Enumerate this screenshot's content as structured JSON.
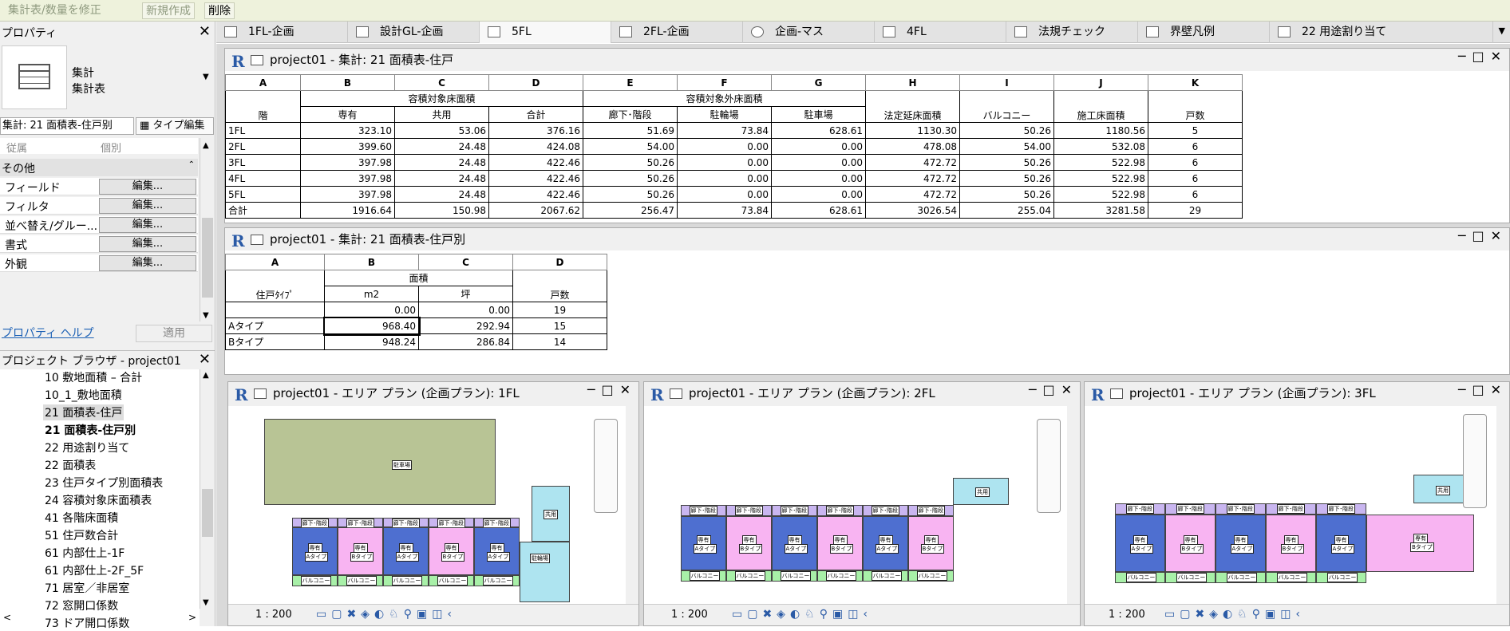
{
  "ribbon": {
    "modify_schedule": "集計表/数量を修正",
    "new": "新規作成",
    "delete": "削除"
  },
  "properties": {
    "title": "プロパティ",
    "type_line1": "集計",
    "type_line2": "集計表",
    "selector": "集計: 21 面積表-住戸别",
    "edit_type": "タイプ編集",
    "col_param": "従属",
    "col_value": "個別",
    "group": "その他",
    "rows": [
      {
        "label": "フィールド",
        "btn": "編集..."
      },
      {
        "label": "フィルタ",
        "btn": "編集..."
      },
      {
        "label": "並べ替え/グルー...",
        "btn": "編集..."
      },
      {
        "label": "書式",
        "btn": "編集..."
      },
      {
        "label": "外観",
        "btn": "編集..."
      }
    ],
    "help": "プロパティ ヘルプ",
    "apply": "適用"
  },
  "browser": {
    "title": "プロジェクト ブラウザ - project01",
    "items": [
      "10 敷地面積 – 合計",
      "10_1_敷地面積",
      "21 面積表-住戸",
      "21 面積表-住戸別",
      "22 用途割り当て",
      "22 面積表",
      "23 住戸タイプ別面積表",
      "24 容積対象床面積表",
      "41 各階床面積",
      "51 住戸数合計",
      "61 内部仕上-1F",
      "61 内部仕上-2F_5F",
      "71 居室／非居室",
      "72 窓開口係数",
      "73 ドア開口係数"
    ]
  },
  "tabs": [
    "1FL-企画",
    "設計GL-企画",
    "5FL",
    "2FL-企画",
    "企画-マス",
    "4FL",
    "法規チェック",
    "界壁凡例",
    "22 用途割り当て"
  ],
  "schedule1": {
    "title": "project01 - 集計: 21 面積表-住戸",
    "cols": [
      "A",
      "B",
      "C",
      "D",
      "E",
      "F",
      "G",
      "H",
      "I",
      "J",
      "K"
    ],
    "group1": "容積対象床面積",
    "group2": "容積対象外床面積",
    "headers": [
      "階",
      "専有",
      "共用",
      "合計",
      "廊下･階段",
      "駐輪場",
      "駐車場",
      "法定延床面積",
      "バルコニー",
      "施工床面積",
      "戸数"
    ],
    "rows": [
      [
        "1FL",
        "323.10",
        "53.06",
        "376.16",
        "51.69",
        "73.84",
        "628.61",
        "1130.30",
        "50.26",
        "1180.56",
        "5"
      ],
      [
        "2FL",
        "399.60",
        "24.48",
        "424.08",
        "54.00",
        "0.00",
        "0.00",
        "478.08",
        "54.00",
        "532.08",
        "6"
      ],
      [
        "3FL",
        "397.98",
        "24.48",
        "422.46",
        "50.26",
        "0.00",
        "0.00",
        "472.72",
        "50.26",
        "522.98",
        "6"
      ],
      [
        "4FL",
        "397.98",
        "24.48",
        "422.46",
        "50.26",
        "0.00",
        "0.00",
        "472.72",
        "50.26",
        "522.98",
        "6"
      ],
      [
        "5FL",
        "397.98",
        "24.48",
        "422.46",
        "50.26",
        "0.00",
        "0.00",
        "472.72",
        "50.26",
        "522.98",
        "6"
      ],
      [
        "合計",
        "1916.64",
        "150.98",
        "2067.62",
        "256.47",
        "73.84",
        "628.61",
        "3026.54",
        "255.04",
        "3281.58",
        "29"
      ]
    ]
  },
  "schedule2": {
    "title": "project01 - 集計: 21 面積表-住戸別",
    "cols": [
      "A",
      "B",
      "C",
      "D"
    ],
    "group": "面積",
    "headers": [
      "住戸ﾀｲﾌﾟ",
      "m2",
      "坪",
      "戸数"
    ],
    "rows": [
      [
        "",
        "0.00",
        "0.00",
        "19"
      ],
      [
        "Aタイプ",
        "968.40",
        "292.94",
        "15"
      ],
      [
        "Bタイプ",
        "948.24",
        "286.84",
        "14"
      ]
    ]
  },
  "plans": [
    {
      "title": "project01 - エリア プラン (企画プラン): 1FL",
      "scale": "1 : 200"
    },
    {
      "title": "project01 - エリア プラン (企画プラン): 2FL",
      "scale": "1 : 200"
    },
    {
      "title": "project01 - エリア プラン (企画プラン): 3FL",
      "scale": "1 : 200"
    }
  ],
  "plan_labels": {
    "corridor": "廊下･階段",
    "owned": "専有",
    "atype": "Aタイプ",
    "btype": "Bタイプ",
    "balcony": "バルコニー",
    "common": "共用",
    "parking": "駐車場",
    "bike": "駐輪場"
  },
  "colors": {
    "unit_a": "#4e6fd0",
    "unit_b": "#f8b4f2",
    "balcony": "#a8f0a8",
    "common": "#aee4f0",
    "parking": "#b8c495"
  }
}
